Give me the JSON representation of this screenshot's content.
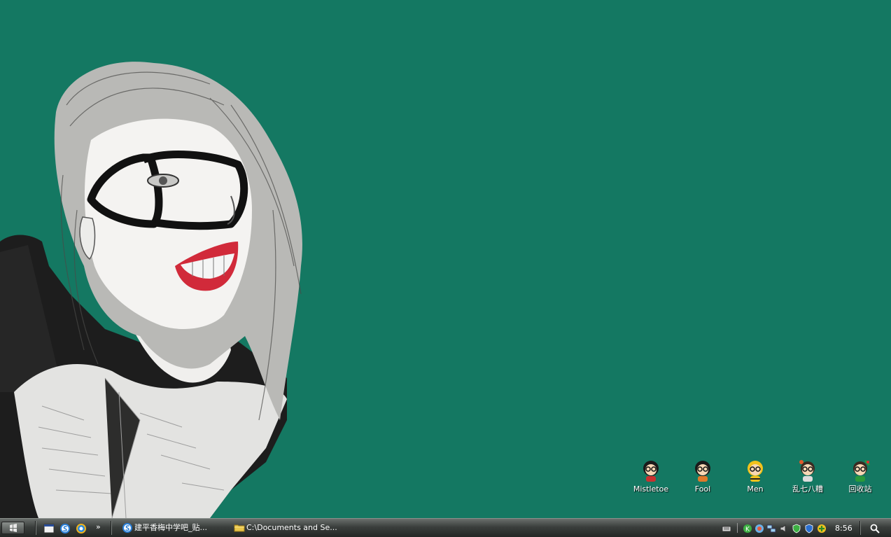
{
  "desktop": {
    "background_color": "#147862",
    "icons": [
      {
        "label": "Mistletoe",
        "icon": "cartoon-girl-icon"
      },
      {
        "label": "Fool",
        "icon": "cartoon-girl-icon"
      },
      {
        "label": "Men",
        "icon": "cartoon-bee-girl-icon"
      },
      {
        "label": "乱七八糟",
        "icon": "cartoon-boy-icon"
      },
      {
        "label": "回收站",
        "icon": "recycle-bin-cartoon-icon"
      }
    ]
  },
  "taskbar": {
    "quick_launch": [
      {
        "icon": "show-desktop-icon"
      },
      {
        "icon": "sogou-browser-icon"
      },
      {
        "icon": "qq-browser-icon"
      }
    ],
    "more_label": "»",
    "tasks": [
      {
        "label": "建平香梅中学吧_贴...",
        "icon": "sogou-browser-icon"
      },
      {
        "label": "C:\\Documents and Se...",
        "icon": "folder-icon"
      }
    ],
    "tray_icons": [
      "keyboard-icon",
      "green-k-icon",
      "network-icon",
      "network-computers-icon",
      "speaker-icon",
      "shield-icon",
      "antivirus-icon",
      "plus-icon"
    ],
    "clock": "8:56"
  }
}
